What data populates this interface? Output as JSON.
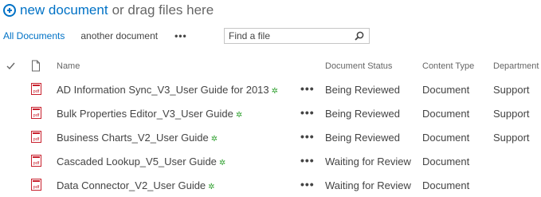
{
  "command_bar": {
    "new_label": "new document",
    "drag_label": "or drag files here"
  },
  "views": {
    "items": [
      "All Documents",
      "another document"
    ],
    "more": "•••"
  },
  "search": {
    "placeholder": "Find a file"
  },
  "table": {
    "headers": {
      "name": "Name",
      "status": "Document Status",
      "content_type": "Content Type",
      "department": "Department"
    },
    "more": "•••",
    "new_marker": "✲",
    "rows": [
      {
        "name": "AD Information Sync_V3_User Guide for 2013",
        "status": "Being Reviewed",
        "content_type": "Document",
        "department": "Support"
      },
      {
        "name": "Bulk Properties Editor_V3_User Guide",
        "status": "Being Reviewed",
        "content_type": "Document",
        "department": "Support"
      },
      {
        "name": "Business Charts_V2_User Guide",
        "status": "Being Reviewed",
        "content_type": "Document",
        "department": "Support"
      },
      {
        "name": "Cascaded Lookup_V5_User Guide",
        "status": "Waiting for Review",
        "content_type": "Document",
        "department": ""
      },
      {
        "name": "Data Connector_V2_User Guide",
        "status": "Waiting for Review",
        "content_type": "Document",
        "department": ""
      }
    ]
  },
  "icons": {
    "new": "plus-circle-icon",
    "search": "magnifier-icon",
    "check": "checkmark-icon",
    "doc_header": "document-icon",
    "file": "pdf-file-icon",
    "new_item": "new-item-star-icon"
  },
  "colors": {
    "accent": "#0072c6",
    "pdf": "#c8202d",
    "new_marker": "#35a335",
    "text": "#444444"
  }
}
